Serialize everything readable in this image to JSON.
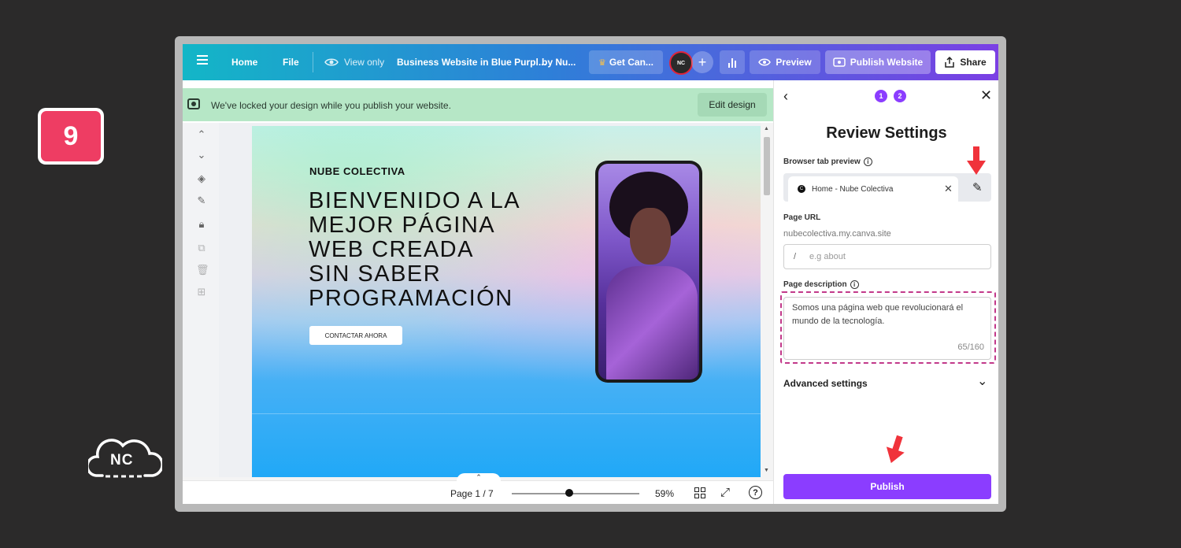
{
  "step_badge": "9",
  "watermark": "NC",
  "topbar": {
    "home": "Home",
    "file": "File",
    "view_only": "View only",
    "title": "Business Website in Blue Purpl...",
    "by": "by Nu...",
    "get_canva": "Get Can...",
    "avatar": "NC",
    "plus": "+",
    "preview": "Preview",
    "publish_website": "Publish Website",
    "share": "Share"
  },
  "banner": {
    "text": "We've locked your design while you publish your website.",
    "edit_design": "Edit design"
  },
  "design": {
    "brand": "NUBE COLECTIVA",
    "headline": [
      "BIENVENIDO A LA",
      "MEJOR PÁGINA",
      "WEB CREADA",
      "SIN SABER",
      "PROGRAMACIÓN"
    ],
    "cta": "CONTACTAR AHORA"
  },
  "bottombar": {
    "page": "Page 1 / 7",
    "zoom": "59%",
    "zoom_level_percent": 45
  },
  "panel": {
    "steps": [
      "1",
      "2"
    ],
    "title": "Review Settings",
    "browser_tab_label": "Browser tab preview",
    "tab_favicon": "C",
    "tab_text": "Home - Nube Colectiva",
    "page_url_label": "Page URL",
    "url_base": "nubecolectiva.my.canva.site",
    "url_prefix": "/",
    "url_placeholder": "e.g about",
    "page_description_label": "Page description",
    "description_line1": "Somos una página web que revolucionará el",
    "description_line2": "mundo de la tecnología.",
    "description_count": "65/160",
    "advanced_settings": "Advanced settings",
    "publish": "Publish"
  },
  "colors": {
    "accent": "#8b3dff",
    "badge": "#ee3d63",
    "banner": "#b6e7c6",
    "highlight": "#c2398a",
    "arrow": "#f0333b"
  }
}
